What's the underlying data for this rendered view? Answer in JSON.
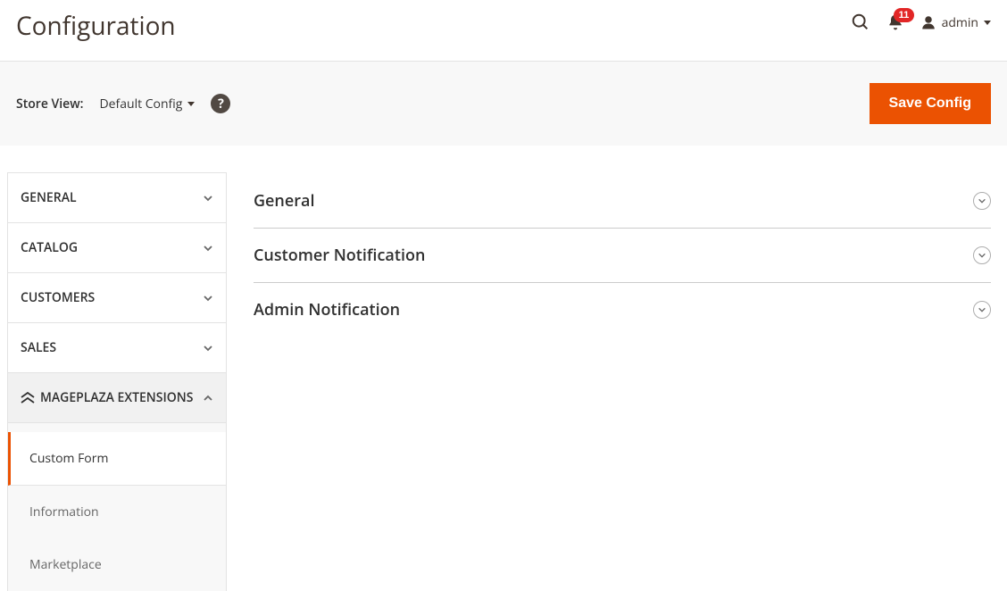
{
  "header": {
    "title": "Configuration",
    "notification_count": "11",
    "username": "admin"
  },
  "toolbar": {
    "store_view_label": "Store View:",
    "store_view_value": "Default Config",
    "save_label": "Save Config"
  },
  "sidebar": {
    "items": [
      {
        "label": "GENERAL",
        "expanded": false
      },
      {
        "label": "CATALOG",
        "expanded": false
      },
      {
        "label": "CUSTOMERS",
        "expanded": false
      },
      {
        "label": "SALES",
        "expanded": false
      },
      {
        "label": "MAGEPLAZA EXTENSIONS",
        "expanded": true
      }
    ],
    "sub_items": [
      {
        "label": "Custom Form",
        "active": true
      },
      {
        "label": "Information",
        "active": false
      },
      {
        "label": "Marketplace",
        "active": false
      }
    ]
  },
  "sections": [
    {
      "title": "General"
    },
    {
      "title": "Customer Notification"
    },
    {
      "title": "Admin Notification"
    }
  ]
}
